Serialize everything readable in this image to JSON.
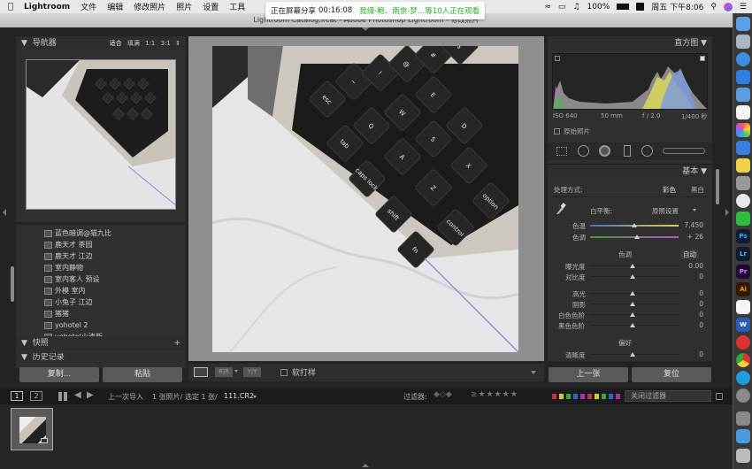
{
  "menubar": {
    "app_name": "Lightroom",
    "items": [
      "文件",
      "编辑",
      "修改照片",
      "照片",
      "设置",
      "工具"
    ],
    "battery": "100%",
    "clock": "周五 下午8:06"
  },
  "share_banner": {
    "label": "正在屏幕分享",
    "time": "00:16:08",
    "message": "我绎-鲍、南京-梦…等10人正在观看"
  },
  "window_title": "Lightroom Catalog.lrcat - Adobe Photoshop Lightroom - 修改照片",
  "navigator": {
    "title": "导航器",
    "zoom_options": [
      "适合",
      "填满",
      "1:1",
      "3:1"
    ]
  },
  "presets": [
    "蓝色暗调@猫九比",
    "鹿天才 茶园",
    "鹿天才 江边",
    "室内静物",
    "室内客人 预设",
    "外模 室内",
    "小兔子 江边",
    "猪猪",
    "yohotel 2",
    "yohotel小清新"
  ],
  "snapshots_title": "快照",
  "history_title": "历史记录",
  "left_buttons": {
    "copy": "复制...",
    "paste": "粘贴"
  },
  "toolbar": {
    "soft_proof": "软打样"
  },
  "histogram": {
    "title": "直方图",
    "iso": "ISO 640",
    "focal": "50 mm",
    "aperture": "f / 2.0",
    "shutter": "1/400 秒",
    "original_photo": "原始照片"
  },
  "basic": {
    "title": "基本",
    "treatment_label": "处理方式:",
    "color": "彩色",
    "bw": "黑白",
    "wb_label": "白平衡:",
    "wb_value": "原照设置",
    "temp_label": "色温",
    "temp_value": "7,450",
    "tint_label": "色调",
    "tint_value": "+ 26",
    "tone_title": "色调",
    "auto": "自动",
    "exposure_label": "曝光度",
    "exposure_value": "0.00",
    "contrast_label": "对比度",
    "contrast_value": "0",
    "highlights_label": "高光",
    "highlights_value": "0",
    "shadows_label": "阴影",
    "shadows_value": "0",
    "whites_label": "白色色阶",
    "whites_value": "0",
    "blacks_label": "黑色色阶",
    "blacks_value": "0",
    "presence_title": "偏好",
    "clarity_label": "清晰度",
    "clarity_value": "0"
  },
  "right_buttons": {
    "prev": "上一张",
    "reset": "复位"
  },
  "filmbar": {
    "page1": "1",
    "page2": "2",
    "source": "上一次导入",
    "count": "1 张照片/ 选定 1 张/",
    "filename": "111.CR2",
    "filter_label": "过滤器:",
    "filter_value": "关闭过滤器"
  },
  "photo_keys": [
    "esc",
    "~",
    "!",
    "@",
    "#",
    "$",
    "tab",
    "Q",
    "W",
    "E",
    "caps lock",
    "A",
    "S",
    "D",
    "shift",
    "Z",
    "X",
    "fn",
    "control",
    "option"
  ]
}
